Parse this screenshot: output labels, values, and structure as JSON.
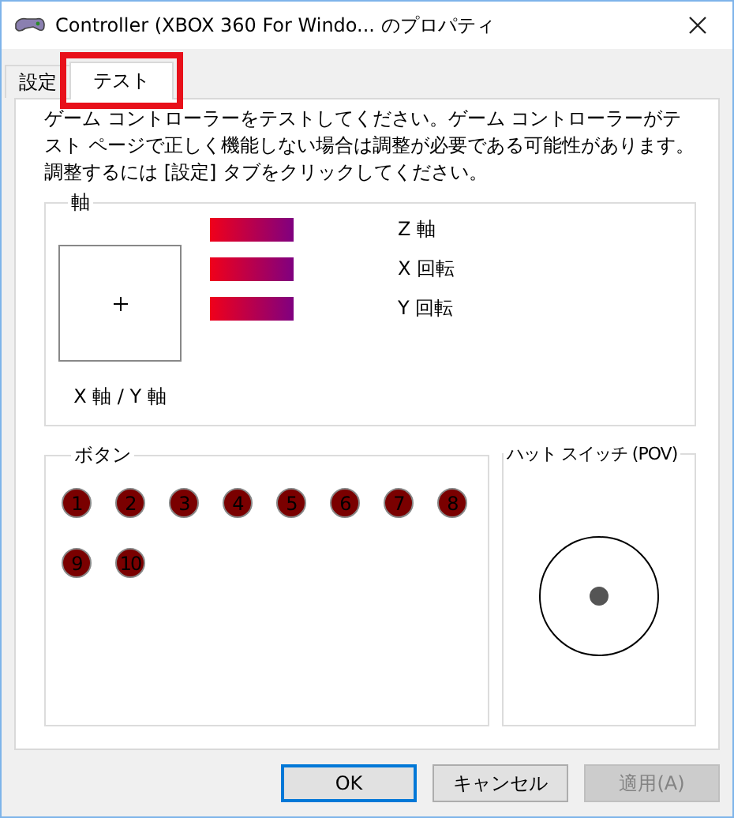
{
  "window": {
    "title": "Controller (XBOX 360 For Windo... のプロパティ"
  },
  "tabs": [
    {
      "label": "設定",
      "selected": false,
      "highlighted": false
    },
    {
      "label": "テスト",
      "selected": true,
      "highlighted": true
    }
  ],
  "description": "ゲーム コントローラーをテストしてください。ゲーム コントローラーがテスト ページで正しく機能しない場合は調整が必要である可能性があります。調整するには [設定] タブをクリックしてください。",
  "axes": {
    "title": "軸",
    "xy_label": "X 軸 / Y 軸",
    "meters": [
      {
        "name": "Z 軸",
        "level": 1
      },
      {
        "name": "X 回転",
        "level": 1
      },
      {
        "name": "Y 回転",
        "level": 1
      }
    ]
  },
  "buttons_group": {
    "title": "ボタン",
    "buttons": [
      {
        "label": "1",
        "pressed": false
      },
      {
        "label": "2",
        "pressed": false
      },
      {
        "label": "3",
        "pressed": false
      },
      {
        "label": "4",
        "pressed": false
      },
      {
        "label": "5",
        "pressed": false
      },
      {
        "label": "6",
        "pressed": false
      },
      {
        "label": "7",
        "pressed": false
      },
      {
        "label": "8",
        "pressed": false
      },
      {
        "label": "9",
        "pressed": false
      },
      {
        "label": "10",
        "pressed": false
      }
    ]
  },
  "pov": {
    "title": "ハット スイッチ (POV)"
  },
  "dialog_buttons": [
    {
      "label": "OK",
      "default": true,
      "disabled": false
    },
    {
      "label": "キャンセル",
      "default": false,
      "disabled": false
    },
    {
      "label": "適用(A)",
      "default": false,
      "disabled": true
    }
  ]
}
